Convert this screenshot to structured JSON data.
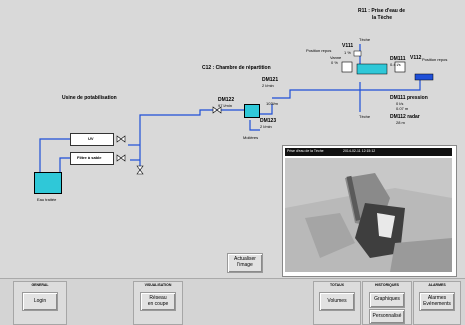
{
  "colors": {
    "pipe": "#1e4fd8",
    "water": "#2fc8d8",
    "panel": "#d9d9d9"
  },
  "synoptic": {
    "r11_title_line1": "R11 : Prise d'eau de",
    "r11_title_line2": "la Tèche",
    "teche_top": "Tèche",
    "teche_bottom": "Tèche",
    "position_left": "Position repos",
    "position_right": "Position repos",
    "v111": "V111",
    "v111_val": "1 %",
    "v112": "V112",
    "valve_small": "Vanne",
    "valve_small_val": "0 %",
    "dm111": "DM111",
    "dm111_val": "0.4 l/s",
    "dm111_pression": "DM111 pression",
    "dm111_p1": "0 l/s",
    "dm111_p2": "0.07 m",
    "dm112": "DM112 radar",
    "dm112_val": "28 m",
    "c12_title": "C12 : Chambre de répartition",
    "dm121": "DM121",
    "dm121_val": "2 l/min",
    "dm122": "DM122",
    "dm122_val": "97 l/min",
    "dm123": "DM123",
    "dm123_val": "2 l/min",
    "small_val": "103l/m",
    "molieres": "Molières",
    "usine_title": "Usine de potabilisation",
    "uv": "UV",
    "filtre": "Filtre à sable",
    "eau_traitee": "Eau traitée"
  },
  "camera": {
    "title": "Prise d'eau de la Tèche",
    "timestamp": "2014-02-11 12:15:12"
  },
  "actualiser": {
    "label_line1": "Actualiser",
    "label_line2": "l'image"
  },
  "bottom": {
    "general": {
      "title": "GENERAL",
      "login": "Login"
    },
    "visualisation": {
      "title": "VISUALISATION",
      "reseau_line1": "Réseau",
      "reseau_line2": "en coupe"
    },
    "totaux": {
      "title": "TOTAUX",
      "volumes": "Volumes"
    },
    "historiques": {
      "title": "HISTORIQUES",
      "graphiques": "Graphiques",
      "personnalise": "Personnalisé"
    },
    "alarmes": {
      "title": "ALARMES",
      "line1": "Alarmes",
      "line2": "Evénements"
    }
  }
}
